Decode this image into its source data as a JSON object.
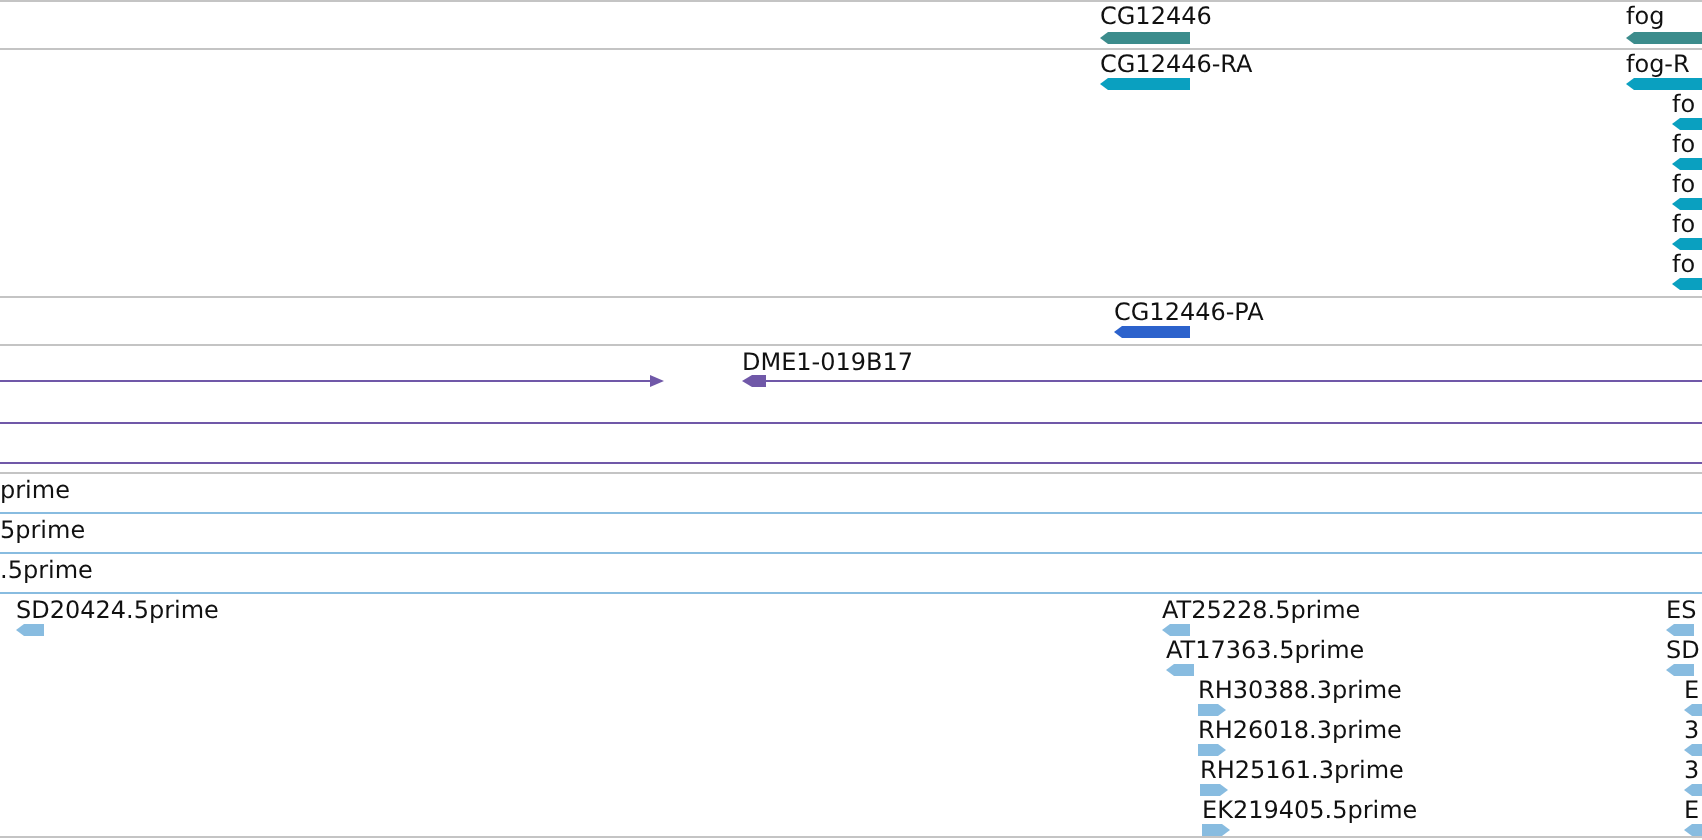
{
  "tracks": [
    {
      "color": "#3c8c8c",
      "features": [
        {
          "kind": "block",
          "label": "CG12446",
          "reverse": true
        },
        {
          "kind": "block",
          "label": "fog",
          "reverse": true
        }
      ]
    },
    {
      "color": "#0aa0c0",
      "features": [
        {
          "kind": "block",
          "label": "CG12446-RA",
          "reverse": true
        },
        {
          "kind": "block",
          "label": "fog-R",
          "reverse": true
        },
        {
          "kind": "block",
          "label": "fo",
          "reverse": true
        },
        {
          "kind": "block",
          "label": "fo",
          "reverse": true
        },
        {
          "kind": "block",
          "label": "fo",
          "reverse": true
        },
        {
          "kind": "block",
          "label": "fo",
          "reverse": true
        },
        {
          "kind": "block",
          "label": "fo",
          "reverse": true
        }
      ]
    },
    {
      "color": "#2c62cc",
      "features": [
        {
          "kind": "block",
          "label": "CG12446-PA",
          "reverse": true
        }
      ]
    },
    {
      "color": "#7058a8",
      "features": [
        {
          "kind": "line",
          "reverse": false
        },
        {
          "kind": "line",
          "label": "DME1-019B17",
          "reverse": true
        },
        {
          "kind": "line"
        },
        {
          "kind": "line"
        }
      ]
    },
    {
      "color": "#88bce0",
      "features": [
        {
          "kind": "line",
          "label": "prime"
        },
        {
          "kind": "line",
          "label": "5prime"
        },
        {
          "kind": "line",
          "label": ".5prime"
        },
        {
          "kind": "block",
          "label": "SD20424.5prime",
          "reverse": true
        },
        {
          "kind": "block",
          "label": "AT25228.5prime",
          "reverse": true
        },
        {
          "kind": "block",
          "label": "AT17363.5prime",
          "reverse": true
        },
        {
          "kind": "block",
          "label": "RH30388.3prime",
          "reverse": false
        },
        {
          "kind": "block",
          "label": "RH26018.3prime",
          "reverse": false
        },
        {
          "kind": "block",
          "label": "RH25161.3prime",
          "reverse": false
        },
        {
          "kind": "block",
          "label": "EK219405.5prime",
          "reverse": false
        },
        {
          "kind": "block",
          "label": "ES",
          "reverse": true
        },
        {
          "kind": "block",
          "label": "SD",
          "reverse": true
        },
        {
          "kind": "block",
          "label": "E",
          "reverse": true
        },
        {
          "kind": "block",
          "label": "3",
          "reverse": true
        },
        {
          "kind": "block",
          "label": "3",
          "reverse": true
        },
        {
          "kind": "block",
          "label": "E",
          "reverse": true
        }
      ]
    }
  ]
}
